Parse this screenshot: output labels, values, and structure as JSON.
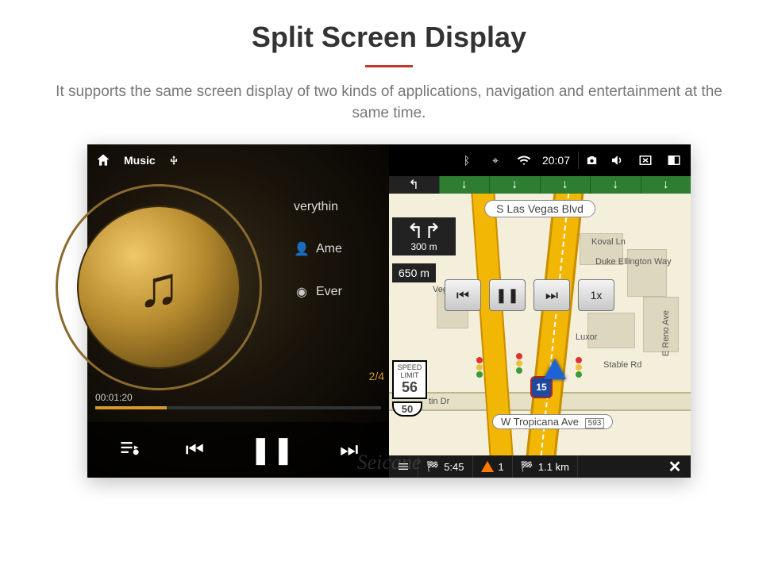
{
  "page": {
    "title": "Split Screen Display",
    "description": "It supports the same screen display of two kinds of applications, navigation and entertainment at the same time."
  },
  "watermark": "Seicane",
  "music": {
    "app_label": "Music",
    "tracks": {
      "current_partial": "verythin",
      "artist_partial": "Ame",
      "playlist_partial": "Ever"
    },
    "track_index": "2/4",
    "elapsed": "00:01:20",
    "controls": {
      "playlist": "playlist",
      "prev": "prev",
      "pause": "pause",
      "next": "next"
    }
  },
  "nav": {
    "status": {
      "time": "20:07"
    },
    "lanes": [
      "↰",
      "↓",
      "↓",
      "↓",
      "↓",
      "↓"
    ],
    "streets": {
      "top_sign": "S Las Vegas Blvd",
      "tropicana": "W Tropicana Ave",
      "tropicana_exit": "593",
      "koval": "Koval Ln",
      "ellington": "Duke Ellington Way",
      "vegas_blvd_short": "Vegas Blvd",
      "reno_ave": "E Reno Ave",
      "tin_dr": "tin Dr"
    },
    "pois": {
      "luxor": "Luxor",
      "stable": "Stable Rd"
    },
    "turn": {
      "direction": "turn-left-then-right",
      "distance": "300 m"
    },
    "distance_next": "650 m",
    "speed_limit_label": "SPEED LIMIT",
    "speed_limit": "56",
    "highway_shield": "50",
    "interstate": "15",
    "play_controls": {
      "prev": "prev",
      "pause": "pause",
      "next": "next",
      "rate": "1x"
    },
    "bottom": {
      "eta": "5:45",
      "warning_count": "1",
      "remaining": "1.1 km"
    }
  }
}
